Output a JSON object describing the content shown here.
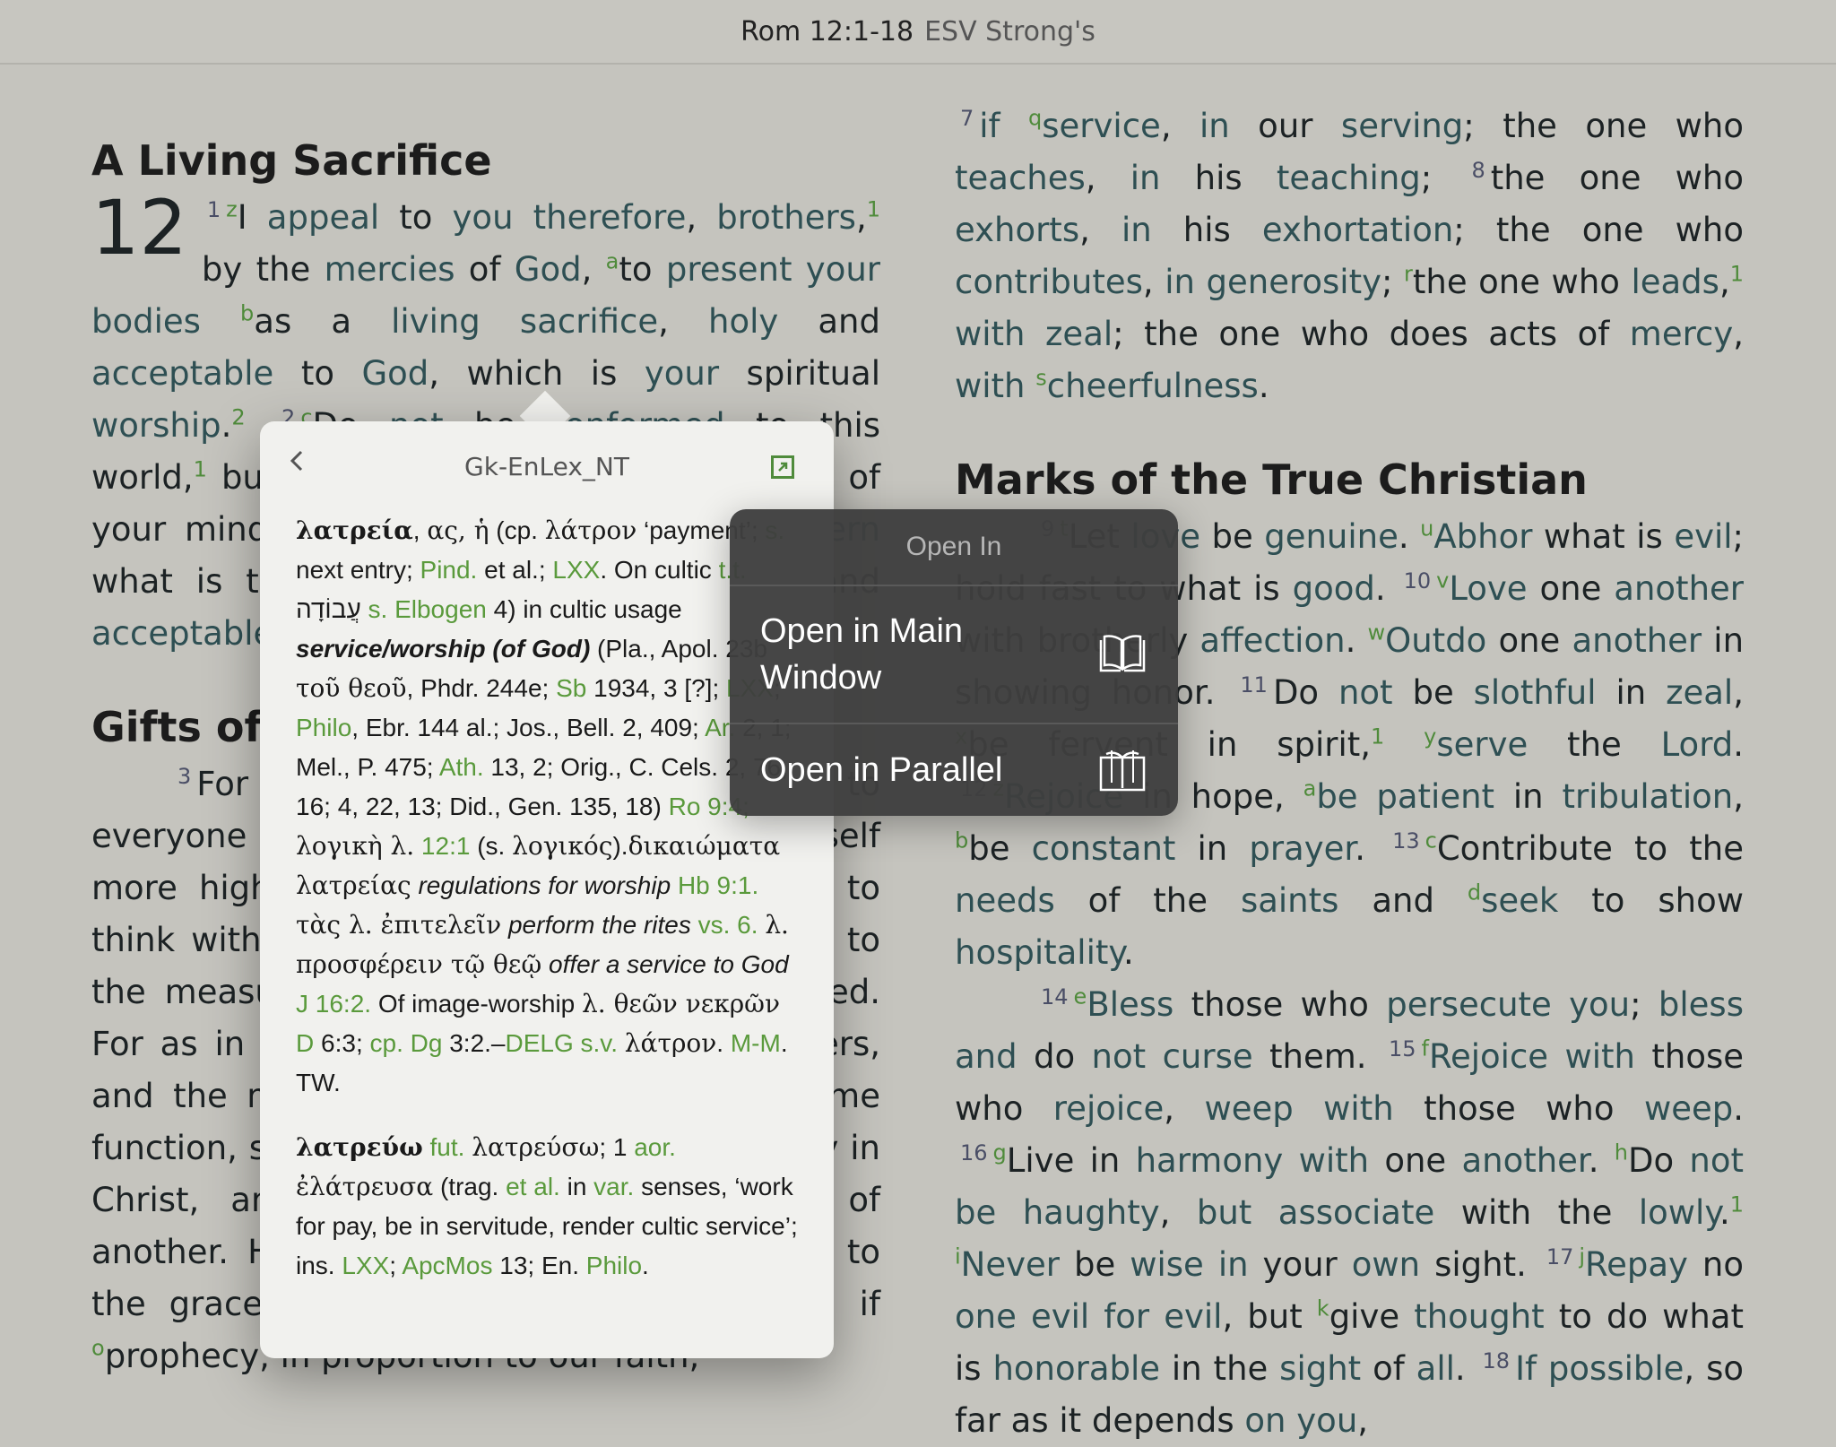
{
  "topbar": {
    "reference": "Rom 12:1-18",
    "version": "ESV Strong's"
  },
  "left": {
    "heading1": "A Living Sacrifice",
    "chapter": "12",
    "heading2": "Gifts of G"
  },
  "right": {
    "heading": "Marks of the True Christian"
  },
  "popover": {
    "title": "Gk-EnLex_NT"
  },
  "menu": {
    "title": "Open In",
    "item1": "Open in Main Window",
    "item2": "Open in Parallel"
  },
  "icons": {
    "back": "chevron-left-icon",
    "expand": "expand-icon",
    "book": "book-icon",
    "parallel": "parallel-books-icon"
  }
}
